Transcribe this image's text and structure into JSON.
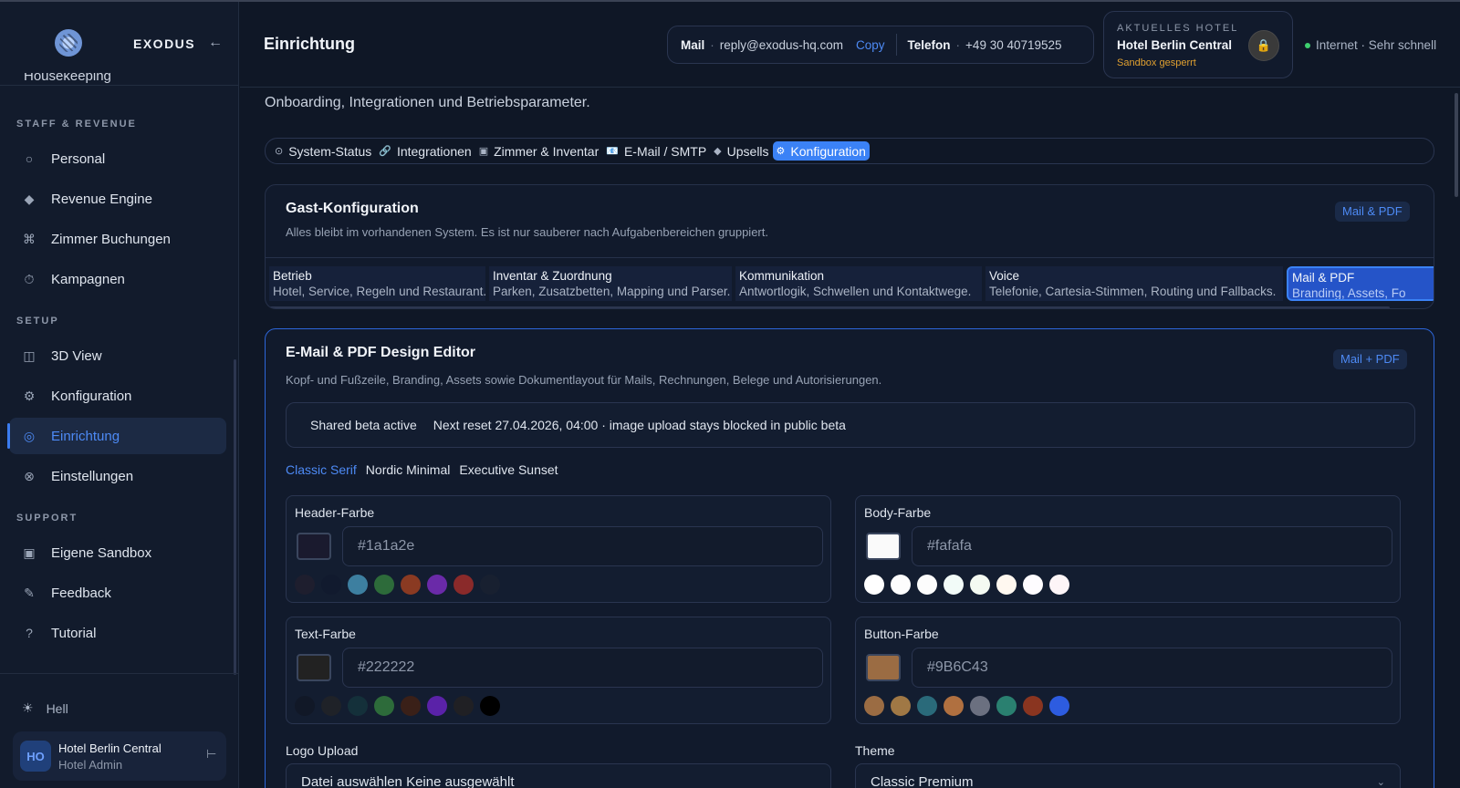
{
  "app": {
    "brand": "EXODUS",
    "collapse_icon": "←"
  },
  "sidebar": {
    "cut_item": "Housekeeping",
    "sections": [
      {
        "title": "STAFF & REVENUE",
        "items": [
          {
            "label": "Personal",
            "icon": "○"
          },
          {
            "label": "Revenue Engine",
            "icon": "◆"
          },
          {
            "label": "Zimmer Buchungen",
            "icon": "⌘"
          },
          {
            "label": "Kampagnen",
            "icon": "⏱"
          }
        ]
      },
      {
        "title": "SETUP",
        "items": [
          {
            "label": "3D View",
            "icon": "◫"
          },
          {
            "label": "Konfiguration",
            "icon": "⚙"
          },
          {
            "label": "Einrichtung",
            "icon": "◎",
            "active": true
          },
          {
            "label": "Einstellungen",
            "icon": "⊗"
          }
        ]
      },
      {
        "title": "SUPPORT",
        "items": [
          {
            "label": "Eigene Sandbox",
            "icon": "▣"
          },
          {
            "label": "Feedback",
            "icon": "✎"
          },
          {
            "label": "Tutorial",
            "icon": "?"
          }
        ]
      }
    ],
    "theme": {
      "icon": "☀",
      "label": "Hell"
    },
    "user": {
      "initials": "HO",
      "name": "Hotel Berlin Central",
      "role": "Hotel Admin",
      "logout_icon": "⊢"
    }
  },
  "header": {
    "title": "Einrichtung",
    "mail_label": "Mail",
    "mail_value": "reply@exodus-hq.com",
    "copy_label": "Copy",
    "phone_label": "Telefon",
    "phone_value": "+49 30 40719525",
    "hotel": {
      "label": "AKTUELLES HOTEL",
      "name": "Hotel Berlin Central",
      "status": "Sandbox gesperrt",
      "lock_icon": "🔒"
    },
    "network": "Internet · Sehr schnell"
  },
  "main": {
    "subtitle": "Onboarding, Integrationen und Betriebsparameter.",
    "tabs": [
      {
        "label": "System-Status",
        "icon": "⊙"
      },
      {
        "label": "Integrationen",
        "icon": "🔗"
      },
      {
        "label": "Zimmer & Inventar",
        "icon": "▣"
      },
      {
        "label": "E-Mail / SMTP",
        "icon": "📧"
      },
      {
        "label": "Upsells",
        "icon": "◆"
      },
      {
        "label": "Konfiguration",
        "icon": "⚙",
        "active": true
      }
    ],
    "gast": {
      "title": "Gast-Konfiguration",
      "desc": "Alles bleibt im vorhandenen System. Es ist nur sauberer nach Aufgabenbereichen gruppiert.",
      "chip": "Mail & PDF",
      "tabs": [
        {
          "title": "Betrieb",
          "desc": "Hotel, Service, Regeln und Restaurant."
        },
        {
          "title": "Inventar & Zuordnung",
          "desc": "Parken, Zusatzbetten, Mapping und Parser."
        },
        {
          "title": "Kommunikation",
          "desc": "Antwortlogik, Schwellen und Kontaktwege."
        },
        {
          "title": "Voice",
          "desc": "Telefonie, Cartesia-Stimmen, Routing und Fallbacks."
        },
        {
          "title": "Mail & PDF",
          "desc": "Branding, Assets, Fo",
          "active": true
        }
      ]
    },
    "editor": {
      "title": "E-Mail & PDF Design Editor",
      "desc": "Kopf- und Fußzeile, Branding, Assets sowie Dokumentlayout für Mails, Rechnungen, Belege und Autorisierungen.",
      "chip": "Mail + PDF",
      "beta_status": "Shared beta active",
      "beta_note": "Next reset 27.04.2026, 04:00 · image upload stays blocked in public beta",
      "presets": [
        "Classic Serif",
        "Nordic Minimal",
        "Executive Sunset"
      ],
      "active_preset": "Classic Serif",
      "colors": [
        {
          "label": "Header-Farbe",
          "value": "#1a1a2e",
          "swatch": "#1a1a2e",
          "palette": [
            "#1e1e2e",
            "#111a2e",
            "#3d7fa0",
            "#2d6b3a",
            "#8a3a22",
            "#6a2aa8",
            "#8a2a2a",
            "#182030"
          ]
        },
        {
          "label": "Body-Farbe",
          "value": "#fafafa",
          "swatch": "#fafafa",
          "palette": [
            "#ffffff",
            "#fdfdfd",
            "#fcfcfc",
            "#f2fbf8",
            "#f4faf2",
            "#fff8f0",
            "#fefcff",
            "#fdf5f7"
          ]
        },
        {
          "label": "Text-Farbe",
          "value": "#222222",
          "swatch": "#222222",
          "palette": [
            "#111827",
            "#1f2228",
            "#14303a",
            "#2d6b3a",
            "#3a2018",
            "#5a22a8",
            "#202024",
            "#000000"
          ]
        },
        {
          "label": "Button-Farbe",
          "value": "#9B6C43",
          "swatch": "#9B6C43",
          "palette": [
            "#9b6c43",
            "#a07845",
            "#2a6a7a",
            "#b07040",
            "#6b7080",
            "#2a8070",
            "#8a3520",
            "#2d5ce0"
          ]
        }
      ],
      "logo_label": "Logo Upload",
      "logo_value": "Datei auswählen Keine ausgewählt",
      "theme_label": "Theme",
      "theme_value": "Classic Premium"
    }
  }
}
